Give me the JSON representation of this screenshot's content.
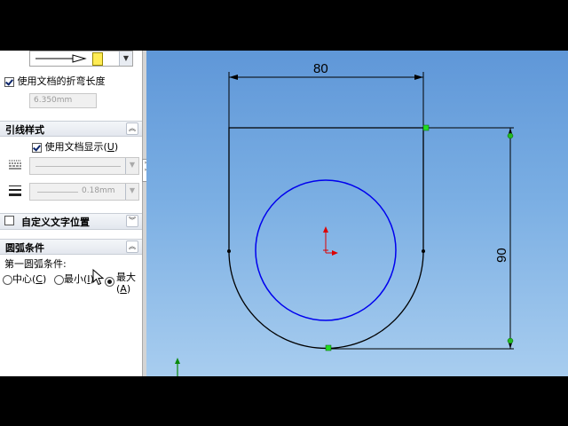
{
  "panel": {
    "arrow_dropdown_icon": "leader-arrow-icon",
    "doc_bend_length_label": "使用文档的折弯长度",
    "bend_length_value": "6.350mm",
    "leader_style_section": "引线样式",
    "use_doc_display_label": "使用文档显示(",
    "use_doc_display_key": "U",
    "use_doc_display_suffix": ")",
    "line_thickness_value": "0.18mm",
    "custom_text_pos_section": "自定义文字位置",
    "arc_condition_section": "圆弧条件",
    "first_arc_label": "第一圆弧条件:",
    "radio_center_label": "中心(",
    "radio_center_key": "C",
    "radio_min_label": "最小(",
    "radio_min_key": "I",
    "radio_max_label": "最大",
    "radio_max_key": "A"
  },
  "drawing": {
    "dim_top": "80",
    "dim_right": "90",
    "colors": {
      "geometry": "#000000",
      "circle": "#0000ee",
      "origin": "#dd0000",
      "endpoint": "#22bb22"
    }
  }
}
